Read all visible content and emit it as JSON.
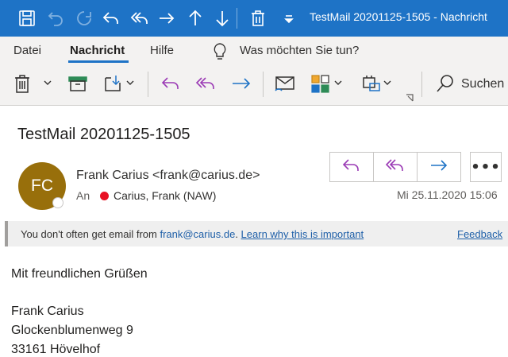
{
  "window": {
    "title": "TestMail 20201125-1505  -  Nachricht",
    "accent": "#1e73c6"
  },
  "quick_access": {
    "icons": [
      "save-icon",
      "undo-icon",
      "redo-icon",
      "reply-icon",
      "reply-all-icon",
      "forward-icon",
      "previous-icon",
      "next-icon",
      "delete-icon",
      "customize-icon"
    ]
  },
  "ribbon": {
    "tabs": [
      {
        "label": "Datei",
        "active": false
      },
      {
        "label": "Nachricht",
        "active": true
      },
      {
        "label": "Hilfe",
        "active": false
      }
    ],
    "tell_me": "Was möchten Sie tun?",
    "search_label": "Suchen"
  },
  "message": {
    "subject": "TestMail 20201125-1505",
    "avatar_initials": "FC",
    "avatar_color": "#986f0b",
    "sender": "Frank Carius <frank@carius.de>",
    "to_label": "An",
    "to_status_color": "#e81123",
    "recipient": "Carius, Frank (NAW)",
    "date": "Mi 25.11.2020 15:06",
    "more_label": "•••"
  },
  "infobar": {
    "text_prefix": "You don't often get email from ",
    "email": "frank@carius.de",
    "text_sep": ". ",
    "link": "Learn why this is important",
    "feedback": "Feedback"
  },
  "body": {
    "lines": [
      "Mit freundlichen Grüßen",
      "Frank Carius",
      "Glockenblumenweg 9",
      "33161 Hövelhof"
    ]
  }
}
